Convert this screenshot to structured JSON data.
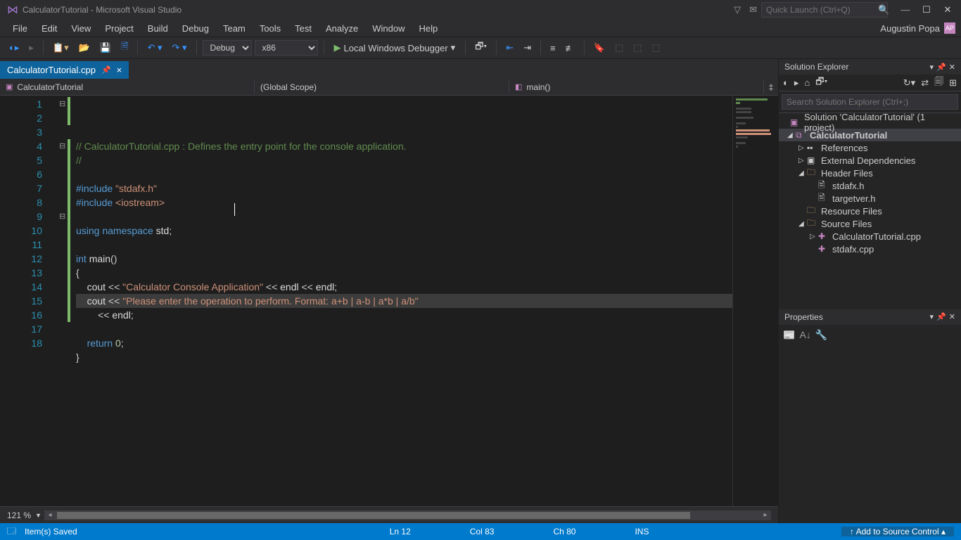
{
  "title": "CalculatorTutorial - Microsoft Visual Studio",
  "quick_launch_placeholder": "Quick Launch (Ctrl+Q)",
  "menu": [
    "File",
    "Edit",
    "View",
    "Project",
    "Build",
    "Debug",
    "Team",
    "Tools",
    "Test",
    "Analyze",
    "Window",
    "Help"
  ],
  "user": "Augustin Popa",
  "toolbar": {
    "config": "Debug",
    "platform": "x86",
    "debugger": "Local Windows Debugger"
  },
  "tab": {
    "name": "CalculatorTutorial.cpp"
  },
  "nav": {
    "project": "CalculatorTutorial",
    "scope": "(Global Scope)",
    "func": "main()"
  },
  "code_lines": [
    {
      "n": 1,
      "fold": "⊟",
      "bar": true,
      "html": "<span class='c-comment'>// CalculatorTutorial.cpp : Defines the entry point for the console application.</span>"
    },
    {
      "n": 2,
      "bar": true,
      "html": "<span class='c-comment'>//</span>"
    },
    {
      "n": 3,
      "html": ""
    },
    {
      "n": 4,
      "fold": "⊟",
      "bar": true,
      "html": "<span class='c-keyword'>#include</span> <span class='c-string'>\"stdafx.h\"</span>"
    },
    {
      "n": 5,
      "bar": true,
      "html": "<span class='c-keyword'>#include</span> <span class='c-string'>&lt;iostream&gt;</span>"
    },
    {
      "n": 6,
      "bar": true,
      "html": ""
    },
    {
      "n": 7,
      "bar": true,
      "html": "<span class='c-keyword'>using</span> <span class='c-keyword'>namespace</span> <span class='c-ident'>std</span>;"
    },
    {
      "n": 8,
      "bar": true,
      "html": ""
    },
    {
      "n": 9,
      "fold": "⊟",
      "bar": true,
      "html": "<span class='c-type'>int</span> <span class='c-ident'>main</span>()"
    },
    {
      "n": 10,
      "bar": true,
      "html": "{"
    },
    {
      "n": 11,
      "bar": true,
      "html": "    <span class='c-ident'>cout</span> &lt;&lt; <span class='c-string'>\"Calculator Console Application\"</span> &lt;&lt; <span class='c-ident'>endl</span> &lt;&lt; <span class='c-ident'>endl</span>;"
    },
    {
      "n": 12,
      "bar": true,
      "hl": true,
      "html": "    <span class='c-ident'>cout</span> &lt;&lt; <span class='c-string'>\"Please enter the operation to perform. Format: a+b | a-b | a*b | a/b\"</span>"
    },
    {
      "n": 13,
      "bar": true,
      "html": "        &lt;&lt; <span class='c-ident'>endl</span>;"
    },
    {
      "n": 14,
      "bar": true,
      "html": ""
    },
    {
      "n": 15,
      "bar": true,
      "html": "    <span class='c-keyword'>return</span> <span class='c-num'>0</span>;"
    },
    {
      "n": 16,
      "bar": true,
      "html": "}"
    },
    {
      "n": 17,
      "html": ""
    },
    {
      "n": 18,
      "html": ""
    }
  ],
  "zoom": "121 %",
  "solution_explorer": {
    "title": "Solution Explorer",
    "search_placeholder": "Search Solution Explorer (Ctrl+;)",
    "solution": "Solution 'CalculatorTutorial' (1 project)",
    "project": "CalculatorTutorial",
    "nodes": {
      "references": "References",
      "external": "External Dependencies",
      "headers": "Header Files",
      "h1": "stdafx.h",
      "h2": "targetver.h",
      "resources": "Resource Files",
      "sources": "Source Files",
      "s1": "CalculatorTutorial.cpp",
      "s2": "stdafx.cpp"
    }
  },
  "properties": {
    "title": "Properties"
  },
  "statusbar": {
    "ready": "Item(s) Saved",
    "ln": "Ln 12",
    "col": "Col 83",
    "ch": "Ch 80",
    "ins": "INS",
    "source_control": "Add to Source Control"
  }
}
